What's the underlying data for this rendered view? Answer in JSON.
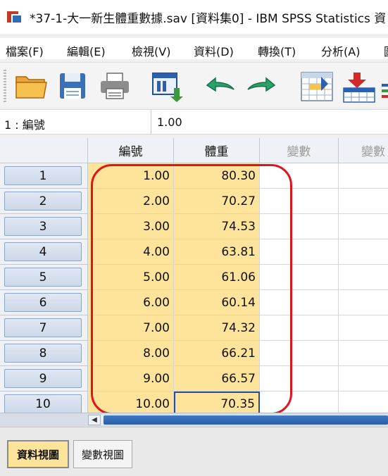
{
  "window": {
    "title": "*37-1-大一新生體重數據.sav [資料集0] - IBM SPSS Statistics 資"
  },
  "menu": [
    "檔案(F)",
    "編輯(E)",
    "檢視(V)",
    "資料(D)",
    "轉換(T)",
    "分析(A)",
    "圖"
  ],
  "toolbar": {
    "icons": [
      "open-folder-icon",
      "save-icon",
      "print-icon",
      "data-view-icon",
      "undo-icon",
      "redo-icon",
      "goto-case-icon",
      "insert-cases-icon",
      "variables-icon"
    ]
  },
  "cellbar": {
    "reference": "1 : 編號",
    "value": "1.00"
  },
  "grid": {
    "columns": [
      "編號",
      "體重",
      "變數",
      "變數"
    ],
    "rows": [
      {
        "n": "1",
        "id": "1.00",
        "weight": "80.30"
      },
      {
        "n": "2",
        "id": "2.00",
        "weight": "70.27"
      },
      {
        "n": "3",
        "id": "3.00",
        "weight": "74.53"
      },
      {
        "n": "4",
        "id": "4.00",
        "weight": "63.81"
      },
      {
        "n": "5",
        "id": "5.00",
        "weight": "61.06"
      },
      {
        "n": "6",
        "id": "6.00",
        "weight": "60.14"
      },
      {
        "n": "7",
        "id": "7.00",
        "weight": "74.32"
      },
      {
        "n": "8",
        "id": "8.00",
        "weight": "66.21"
      },
      {
        "n": "9",
        "id": "9.00",
        "weight": "66.57"
      },
      {
        "n": "10",
        "id": "10.00",
        "weight": "70.35"
      }
    ]
  },
  "tabs": {
    "data_view": "資料視圖",
    "variable_view": "變數視圖"
  },
  "colors": {
    "highlight": "#fde49a",
    "annotation": "#e0141b",
    "selection": "#1f4db5"
  }
}
